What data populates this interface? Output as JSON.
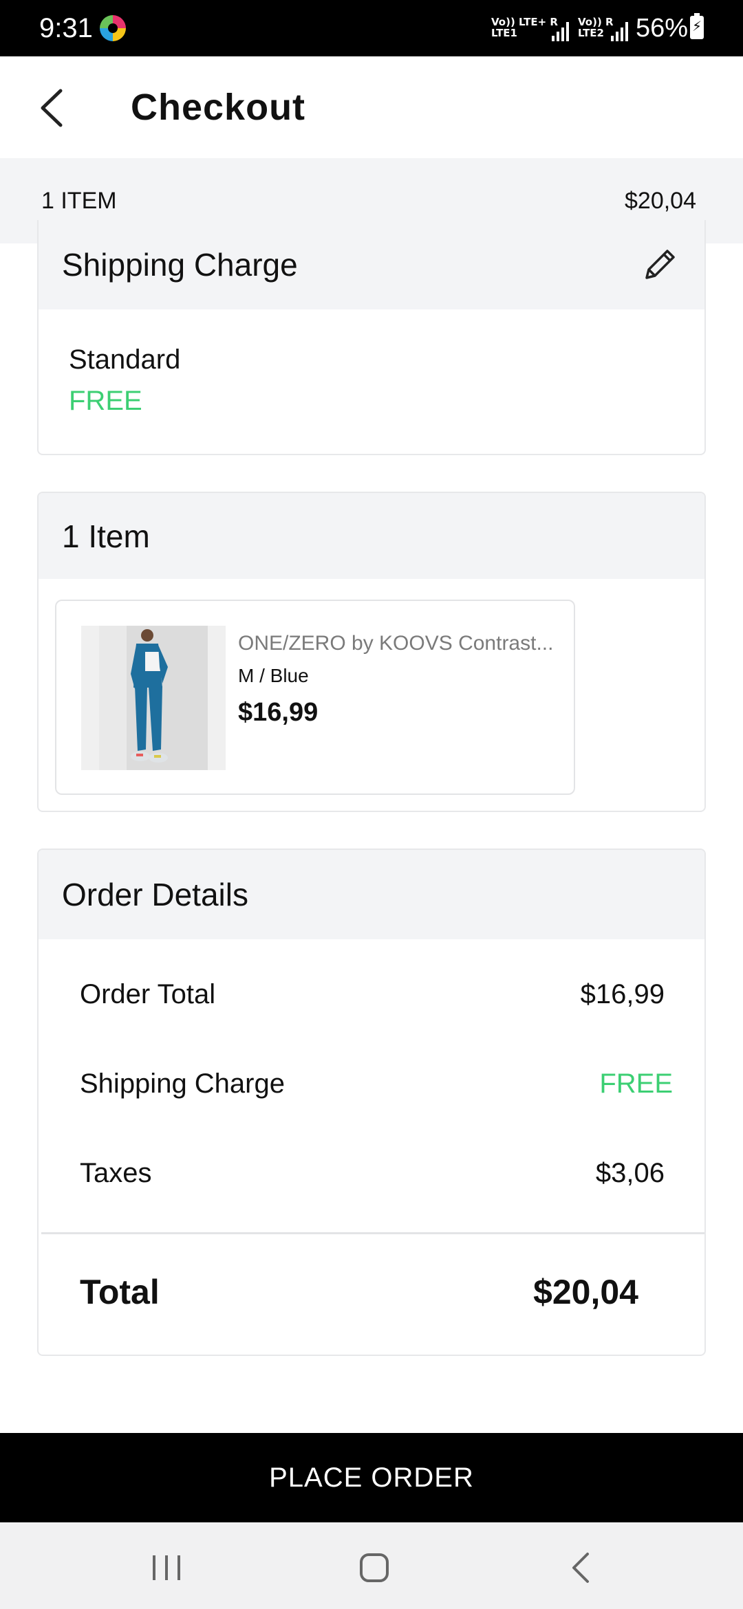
{
  "status_bar": {
    "time": "9:31",
    "sim1_top": "Vo)) LTE+ R",
    "sim1_bottom": "LTE1",
    "sim2_top": "Vo)) R",
    "sim2_bottom": "LTE2",
    "battery_percent": "56%",
    "app_icon": "color-wheel-icon"
  },
  "header": {
    "title": "Checkout",
    "back_icon": "chevron-left-icon"
  },
  "summary": {
    "item_count": "1 ITEM",
    "total": "$20,04"
  },
  "shipping": {
    "title": "Shipping Charge",
    "edit_icon": "pencil-icon",
    "method": "Standard",
    "cost": "FREE"
  },
  "items": {
    "title": "1 Item",
    "list": [
      {
        "name": "ONE/ZERO by KOOVS Contrast...",
        "variant": "M / Blue",
        "price": "$16,99"
      }
    ]
  },
  "order_details": {
    "title": "Order Details",
    "rows": [
      {
        "label": "Order Total",
        "value": "$16,99"
      },
      {
        "label": "Shipping Charge",
        "value": "FREE"
      },
      {
        "label": "Taxes",
        "value": "$3,06"
      }
    ],
    "total_label": "Total",
    "total_value": "$20,04"
  },
  "actions": {
    "place_order": "PLACE ORDER"
  },
  "nav_bar": {
    "recents_icon": "recents-icon",
    "home_icon": "home-icon",
    "back_icon": "back-icon"
  },
  "colors": {
    "free_green": "#3ccf73",
    "header_gray": "#f3f4f6",
    "button_black": "#000000"
  }
}
